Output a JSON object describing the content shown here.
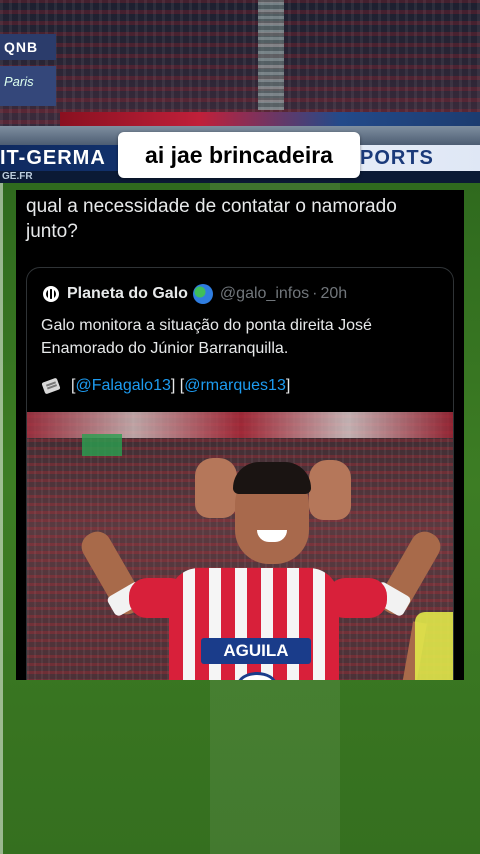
{
  "video": {
    "caption": "ai jae brincadeira",
    "board_left_text": "IT-GERMA",
    "board_right_text": "PORTS",
    "sponsor_left_top": "QNB",
    "sponsor_left_bottom": "Paris",
    "sub_board_text": "GE.FR"
  },
  "tweet": {
    "reply_text": "qual a necessidade de contatar o namorado junto?",
    "quote": {
      "author_name": "Planeta do Galo",
      "author_emoji_icon": "globe-icon",
      "handle": "@galo_infos",
      "separator": "·",
      "time": "20h",
      "body": "Galo monitora a situação do ponta direita José Enamorado do Júnior Barranquilla.",
      "link_1": "@Falagalo13",
      "link_2": "@rmarques13",
      "image": {
        "shirt_sponsor": "AGUILA"
      }
    }
  },
  "colors": {
    "link": "#1d9bf0",
    "text": "#e7e9ea",
    "muted": "#71767b",
    "pitch": "#3d7d24"
  }
}
